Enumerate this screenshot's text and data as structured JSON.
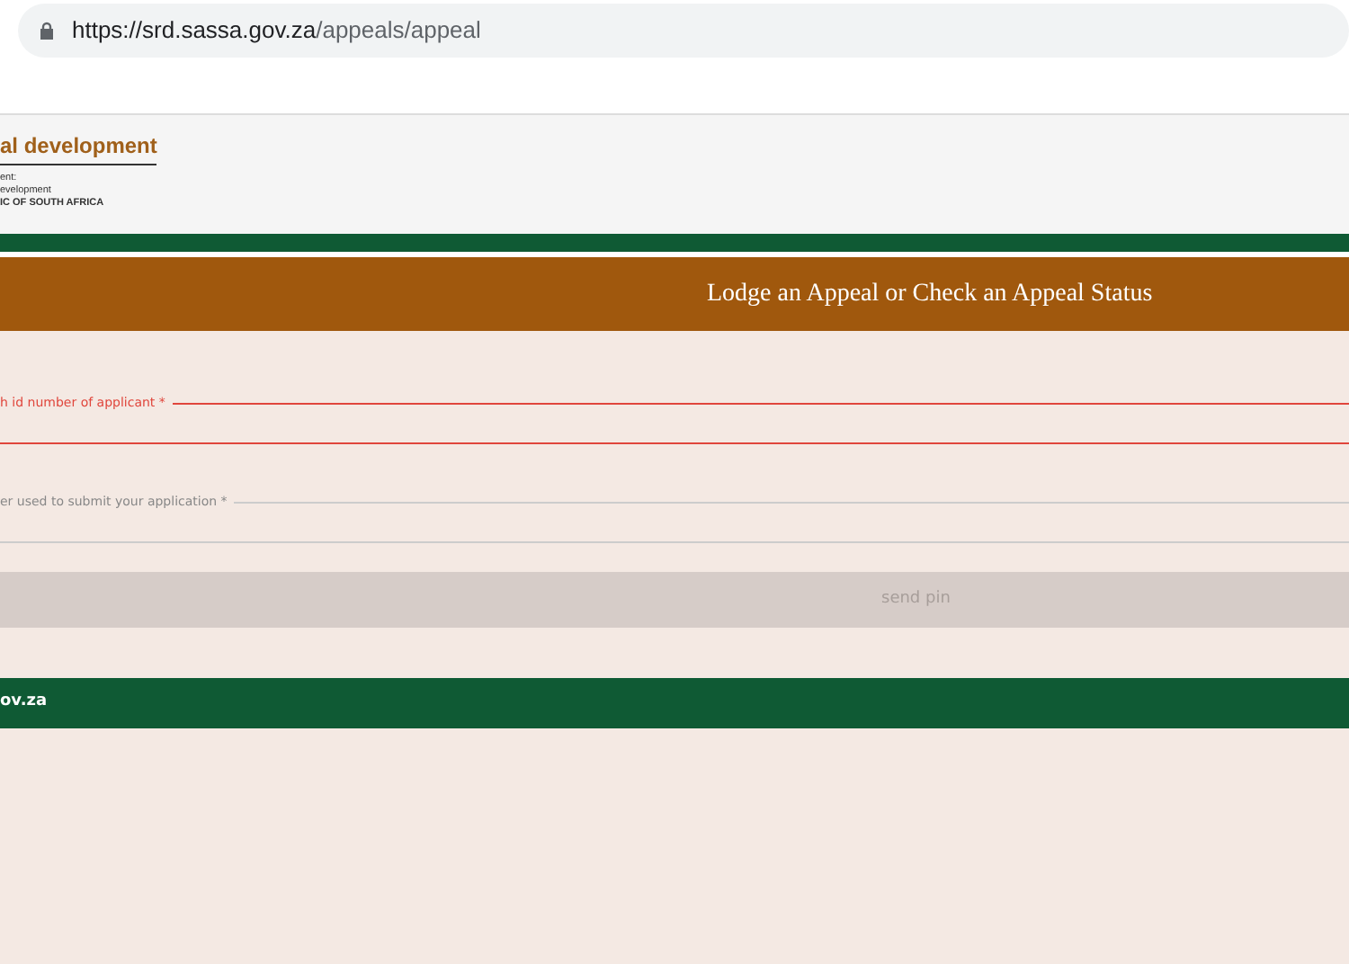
{
  "address_bar": {
    "url_host": "https://srd.sassa.gov.za",
    "url_path": "/appeals/appeal"
  },
  "header": {
    "logo_title": "al development",
    "logo_lines": [
      "ent:",
      "evelopment",
      "IC OF SOUTH AFRICA"
    ]
  },
  "banner": {
    "title": "Lodge an Appeal or Check an Appeal Status"
  },
  "fields": [
    {
      "label": "h id number of applicant *",
      "invalid": true
    },
    {
      "label": "er used to submit your application *",
      "invalid": false
    }
  ],
  "send_button": {
    "label": "send pin",
    "disabled": true
  },
  "footer": {
    "text": "ov.za"
  }
}
